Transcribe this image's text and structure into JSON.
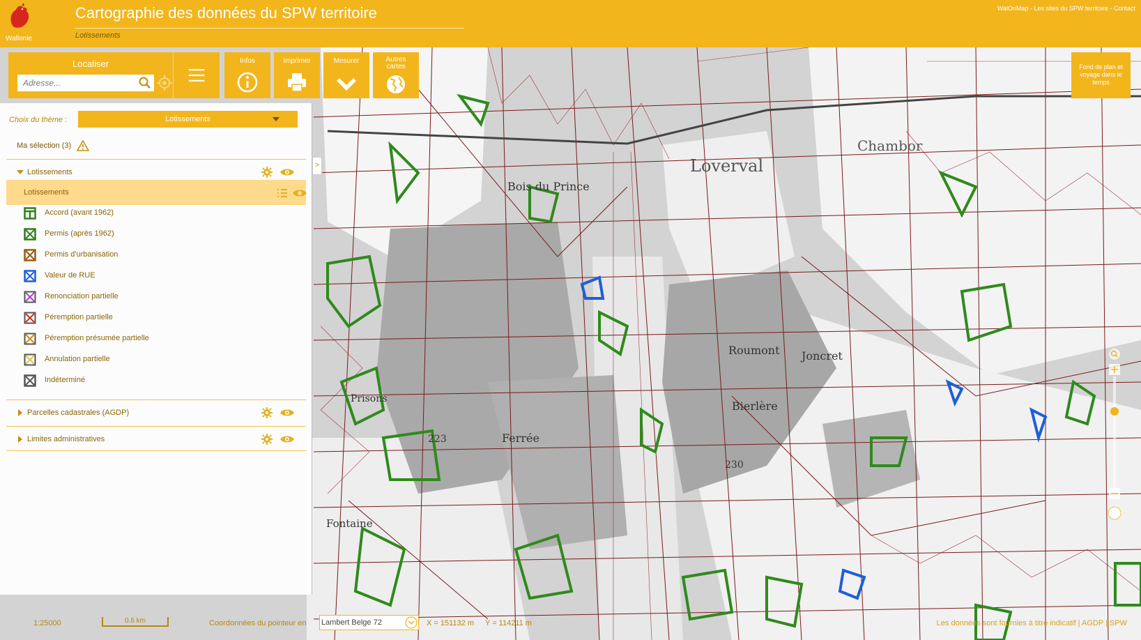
{
  "header": {
    "logo_label": "Wallonie",
    "title": "Cartographie des données du SPW territoire",
    "subtitle": "Lotissements",
    "top_links": "WalOnMap - Les sites du SPW territoire - Contact"
  },
  "toolbar": {
    "localiser_label": "Localiser",
    "address_placeholder": "Adresse...",
    "infos_label": "Infos",
    "imprimer_label": "Imprimer",
    "mesurer_label": "Mesurer",
    "autres_cartes_label": "Autres cartes",
    "fond_plan_label": "Fond de plan et voyage dans le temps"
  },
  "panel": {
    "theme_label": "Choix du thème :",
    "theme_value": "Lotissements",
    "selection_label": "Ma sélection (3)",
    "layers": [
      {
        "label": "Lotissements",
        "expanded": true
      },
      {
        "label": "Parcelles cadastrales (AGDP)",
        "expanded": false
      },
      {
        "label": "Limites administratives",
        "expanded": false
      }
    ],
    "sublayer_label": "Lotissements",
    "legend": [
      {
        "label": "Accord (avant 1962)",
        "color": "#2f7d1c",
        "icon": "accord-icon"
      },
      {
        "label": "Permis (après 1962)",
        "color": "#2f7d1c",
        "icon": "cross-box-icon"
      },
      {
        "label": "Permis d'urbanisation",
        "color": "#9b5a13",
        "icon": "cross-box-icon"
      },
      {
        "label": "Valeur de RUE",
        "color": "#1f5ed6",
        "icon": "cross-box-icon"
      },
      {
        "label": "Renonciation partielle",
        "color": "#b23fd6",
        "icon": "cross-box-icon"
      },
      {
        "label": "Péremption partielle",
        "color": "#d12c1c",
        "icon": "cross-box-icon"
      },
      {
        "label": "Péremption présumée partielle",
        "color": "#d48a10",
        "icon": "cross-box-icon"
      },
      {
        "label": "Annulation partielle",
        "color": "#e0c24a",
        "icon": "cross-box-icon"
      },
      {
        "label": "Indéterminé",
        "color": "#555555",
        "icon": "cross-box-icon"
      }
    ]
  },
  "map_labels": {
    "loverval": "Loverval",
    "bois_du_prince": "Bois du Prince",
    "bois_de_roumont": "Roumont",
    "joncret": "Joncret",
    "chambor": "Chambor",
    "bierlere": "Bierlère",
    "ferree": "Ferrée",
    "prisons": "Prisons",
    "fontaine": "Fontaine",
    "alt_223": "223",
    "alt_230": "230"
  },
  "statusbar": {
    "scale": "1:25000",
    "scale_bar": "0.6 km",
    "coords_label": "Coordonnées du pointeur en",
    "crs": "Lambert Belge 72",
    "x": "X = 151132 m",
    "y": "Y = 114211 m",
    "footer_note": "Les données sont fournies à titre indicatif | AGDP | SPW"
  },
  "colors": {
    "brand": "#f2b51c",
    "parcel_lines": "#7a1a1a",
    "lot_green": "#2f8a1c",
    "lot_blue": "#1f5ed6"
  }
}
